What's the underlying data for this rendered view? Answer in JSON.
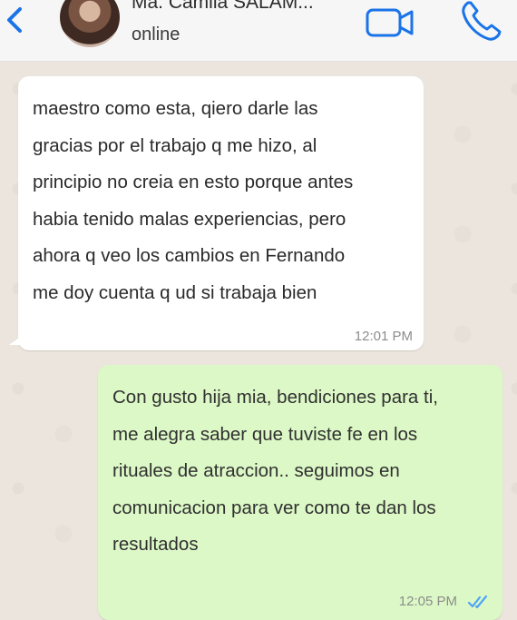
{
  "header": {
    "contact_name": "Ma. Camila SALAM...",
    "status": "online"
  },
  "messages": [
    {
      "direction": "incoming",
      "text": "maestro como esta, qiero darle las\ngracias por el trabajo q me hizo, al\nprincipio no creia en esto porque antes\nhabia tenido malas experiencias, pero\nahora q veo los cambios en Fernando\nme doy cuenta q ud si trabaja bien",
      "time": "12:01 PM"
    },
    {
      "direction": "outgoing",
      "text": "Con gusto hija mia, bendiciones para ti,\nme alegra saber que tuviste fe en los\nrituales de atraccion.. seguimos en\ncomunicacion para ver como te dan los\nresultados",
      "time": "12:05 PM",
      "status_icon": "double-check-read-icon"
    }
  ],
  "colors": {
    "accent": "#1a73e8",
    "outgoing_bubble": "#dcf8c6",
    "incoming_bubble": "#ffffff",
    "read_ticks": "#4fa3f7"
  }
}
